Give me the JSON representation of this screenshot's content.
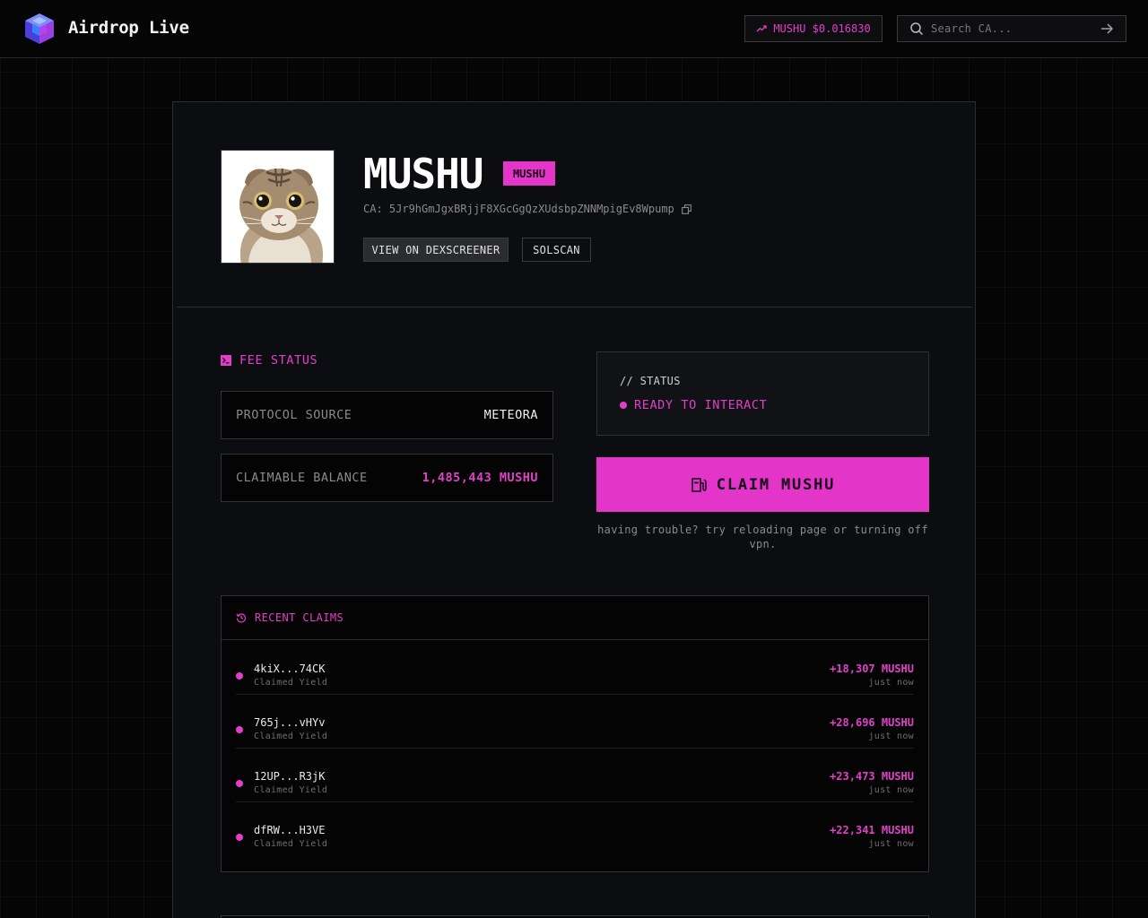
{
  "header": {
    "brand": "Airdrop Live",
    "price_ticker": "MUSHU $0.016830",
    "search_placeholder": "Search CA..."
  },
  "token": {
    "name": "MUSHU",
    "badge": "MUSHU",
    "ca": "CA: 5Jr9hGmJgxBRjjF8XGcGgQzXUdsbpZNNMpigEv8Wpump",
    "buttons": {
      "dexscreener": "VIEW ON DEXSCREENER",
      "solscan": "SOLSCAN"
    }
  },
  "fee_status": {
    "title": "FEE STATUS",
    "rows": [
      {
        "label": "PROTOCOL SOURCE",
        "value": "METEORA"
      },
      {
        "label": "CLAIMABLE BALANCE",
        "value": "1,485,443 MUSHU"
      }
    ]
  },
  "status": {
    "label": "// STATUS",
    "value": "READY TO INTERACT"
  },
  "claim": {
    "button": "CLAIM MUSHU",
    "help": "having trouble? try reloading page or turning off vpn."
  },
  "recent_claims": {
    "title": "RECENT CLAIMS",
    "items": [
      {
        "address": "4kiX...74CK",
        "type": "Claimed Yield",
        "amount": "+18,307 MUSHU",
        "time": "just now"
      },
      {
        "address": "765j...vHYv",
        "type": "Claimed Yield",
        "amount": "+28,696 MUSHU",
        "time": "just now"
      },
      {
        "address": "12UP...R3jK",
        "type": "Claimed Yield",
        "amount": "+23,473 MUSHU",
        "time": "just now"
      },
      {
        "address": "dfRW...H3VE",
        "type": "Claimed Yield",
        "amount": "+22,341 MUSHU",
        "time": "just now"
      }
    ]
  },
  "colors": {
    "accent": "#e335c7",
    "background": "#050505",
    "card": "#0c0d10"
  }
}
